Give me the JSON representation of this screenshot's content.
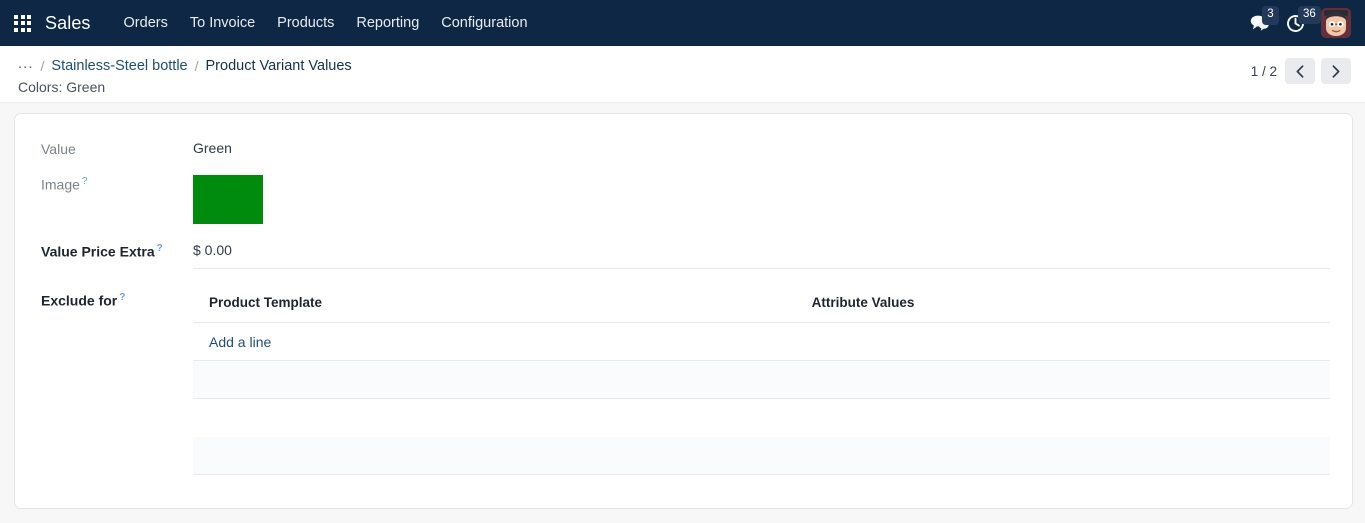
{
  "navbar": {
    "apps_icon": "apps-grid-icon",
    "brand": "Sales",
    "menu": [
      {
        "label": "Orders"
      },
      {
        "label": "To Invoice"
      },
      {
        "label": "Products"
      },
      {
        "label": "Reporting"
      },
      {
        "label": "Configuration"
      }
    ],
    "messages": {
      "icon": "chat-bubbles-icon",
      "count": "3"
    },
    "activities": {
      "icon": "clock-icon",
      "count": "36"
    },
    "avatar": {
      "icon": "user-avatar"
    },
    "background_color": "#0d2745"
  },
  "breadcrumb": {
    "overflow": "...",
    "separator": "/",
    "items": [
      {
        "label": "Stainless-Steel bottle",
        "active": false
      },
      {
        "label": "Product Variant Values",
        "active": true
      }
    ],
    "subtitle": "Colors: Green"
  },
  "pager": {
    "count": "1 / 2",
    "prev_icon": "chevron-left-icon",
    "next_icon": "chevron-right-icon"
  },
  "form": {
    "fields": {
      "value": {
        "label": "Value",
        "value": "Green"
      },
      "image": {
        "label": "Image",
        "help": "?",
        "swatch_color": "#008a0e"
      },
      "price_extra": {
        "label": "Value Price Extra",
        "help": "?",
        "value": "$ 0.00"
      },
      "exclude_for": {
        "label": "Exclude for",
        "help": "?"
      }
    },
    "exclude_table": {
      "columns": [
        "Product Template",
        "Attribute Values"
      ],
      "rows": [],
      "add_line_label": "Add a line"
    }
  },
  "colors": {
    "accent": "#1f4e79",
    "swatch_green": "#008a0e",
    "navbar": "#0d2745",
    "page_bg": "#f7f7f8"
  }
}
